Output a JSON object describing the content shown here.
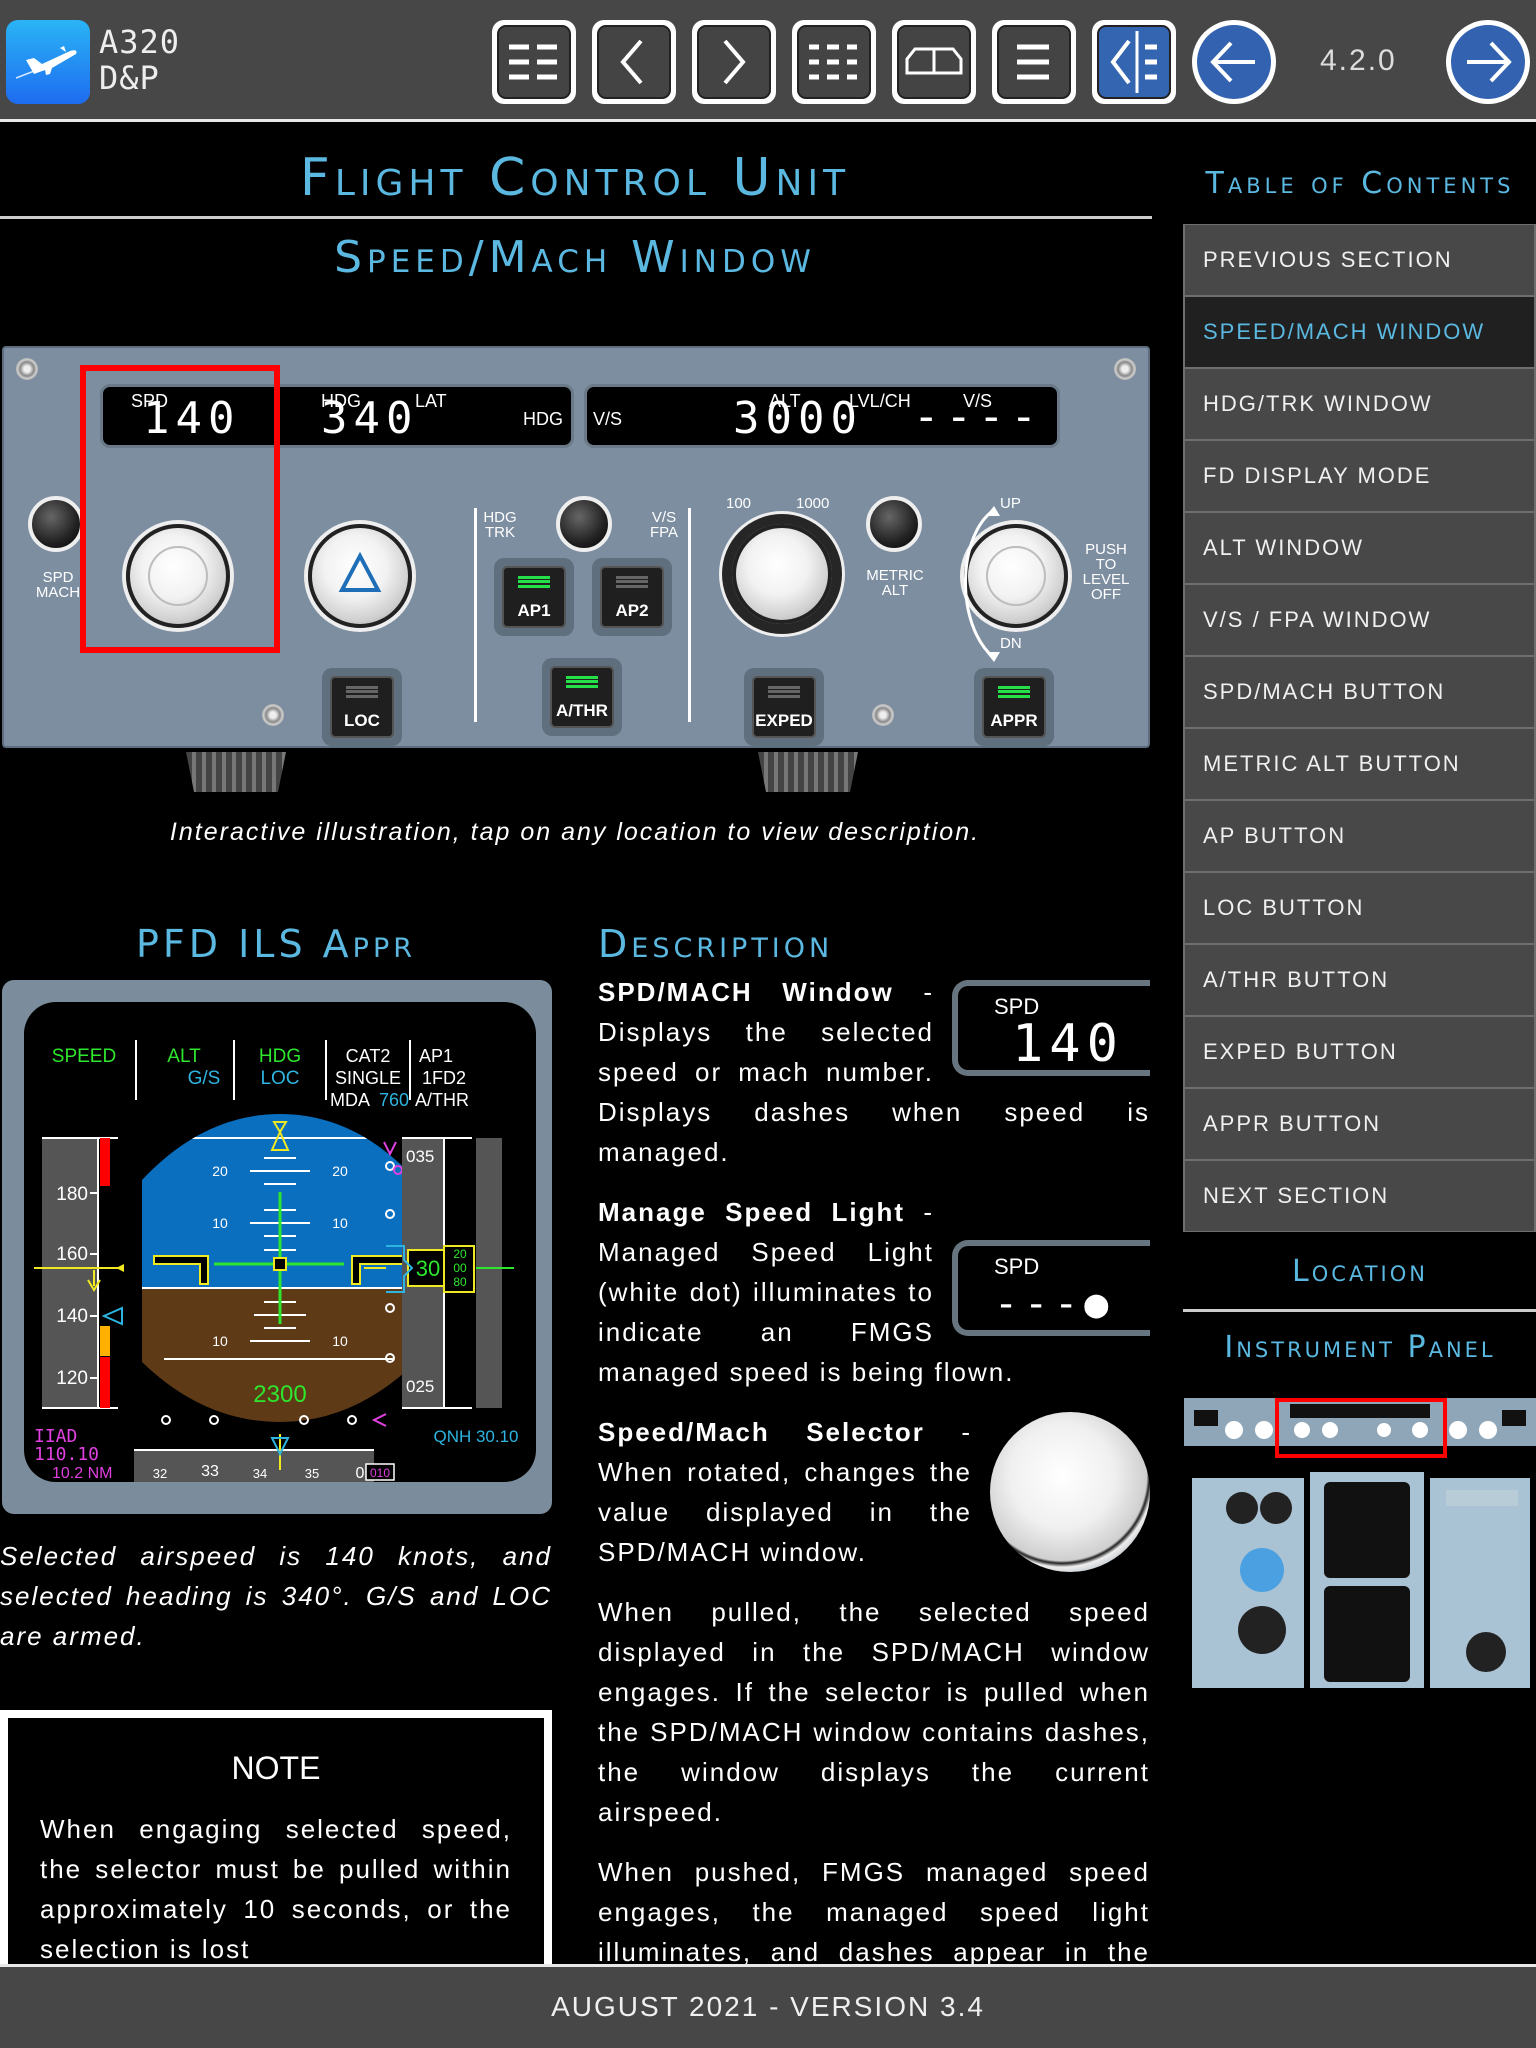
{
  "app": {
    "name_line1": "A320",
    "name_line2": "D&P",
    "version": "4.2.0"
  },
  "toolbar": {
    "buttons": [
      {
        "name": "menu-grid-icon",
        "active": false
      },
      {
        "name": "chevron-left-icon",
        "active": false
      },
      {
        "name": "chevron-right-icon",
        "active": false
      },
      {
        "name": "list-grid-icon",
        "active": false
      },
      {
        "name": "panel-overview-icon",
        "active": false
      },
      {
        "name": "list-icon",
        "active": false
      },
      {
        "name": "toc-sidebar-icon",
        "active": true
      }
    ],
    "back_icon": "arrow-left-icon",
    "forward_icon": "arrow-right-icon"
  },
  "header": {
    "title": "Flight Control Unit",
    "subtitle": "Speed/Mach Window"
  },
  "fcu": {
    "spd_label": "SPD",
    "spd_value": "140",
    "hdg_label": "HDG",
    "lat_label": "LAT",
    "hdg_value": "340",
    "hdg_right_label": "HDG",
    "vs_label": "V/S",
    "alt_label": "ALT",
    "lvlch_label": "LVL/CH",
    "vs_label2": "V/S",
    "alt_value": "3000",
    "vs_value": "----",
    "spd_mach_label": "SPD\nMACH",
    "hdg_trk_label": "HDG\nTRK",
    "vs_fpa_label": "V/S\nFPA",
    "alt_100": "100",
    "alt_1000": "1000",
    "metric_alt_label": "METRIC\nALT",
    "up_label": "UP",
    "dn_label": "DN",
    "push_label": "PUSH\nTO\nLEVEL\nOFF",
    "buttons": [
      {
        "label": "LOC",
        "on": false
      },
      {
        "label": "AP1",
        "on": true
      },
      {
        "label": "AP2",
        "on": false
      },
      {
        "label": "A/THR",
        "on": true
      },
      {
        "label": "EXPED",
        "on": false
      },
      {
        "label": "APPR",
        "on": true
      }
    ]
  },
  "caption": "Interactive illustration, tap on any location to view description.",
  "pfd_section": {
    "title": "PFD ILS Appr",
    "fma": {
      "col1": "SPEED",
      "col2a": "ALT",
      "col2b": "G/S",
      "col3a": "HDG",
      "col3b": "LOC",
      "col4a": "CAT2",
      "col4b": "SINGLE",
      "col4c": "MDA",
      "col4d": "760",
      "col5a": "AP1",
      "col5b": "1FD2",
      "col5c": "A/THR"
    },
    "speed_ticks": [
      "180",
      "160",
      "140",
      "120"
    ],
    "pitch_labels": [
      "20",
      "10",
      "10"
    ],
    "alt_ticks": [
      "035",
      "025"
    ],
    "alt_readout": "30",
    "alt_drum": [
      "20",
      "00",
      "80"
    ],
    "decision_alt": "2300",
    "ils_ident": "IIAD",
    "ils_freq": "110.10",
    "ils_dist": "10.2 NM",
    "qnh": "QNH 30.10",
    "heading_ticks": [
      "32",
      "33",
      "34",
      "35",
      "0"
    ],
    "heading_box": "010",
    "colors": {
      "green": "#2ee62e",
      "cyan": "#2eb4e0",
      "magenta": "#e040e0",
      "yellow": "#f0e820",
      "sky": "#0a6fbf",
      "ground": "#5e3a16"
    },
    "caption": "Selected airspeed is 140 knots, and selected heading is 340°. G/S and LOC are armed."
  },
  "note": {
    "title": "NOTE",
    "body": "When engaging selected speed, the selector must be pulled within approximately 10 seconds, or the selection is lost"
  },
  "description": {
    "title": "Description",
    "items": [
      {
        "heading": "SPD/MACH Window",
        "text": " - Displays the selected speed or mach number. Displays dashes when speed is managed.",
        "lcd_label": "SPD",
        "lcd_value": "140"
      },
      {
        "heading": "Manage Speed Light",
        "text": " - Managed Speed Light (white dot) illuminates to indicate an FMGS managed speed is being flown.",
        "lcd_label": "SPD",
        "lcd_value": "---●"
      },
      {
        "heading": "Speed/Mach Selector",
        "text": " - When rotated, changes the value displayed in the SPD/MACH window."
      }
    ],
    "paragraphs": [
      "When pulled, the selected speed displayed in the SPD/MACH window engages. If the selector is pulled when the SPD/MACH window contains dashes, the window displays the current airspeed.",
      "When pushed, FMGS managed speed engages, the managed speed light illuminates, and dashes appear in the SPD/MACH window."
    ]
  },
  "toc": {
    "title": "Table of Contents",
    "items": [
      {
        "label": "PREVIOUS SECTION",
        "active": false
      },
      {
        "label": "SPEED/MACH WINDOW",
        "active": true
      },
      {
        "label": "HDG/TRK WINDOW",
        "active": false
      },
      {
        "label": "FD DISPLAY MODE",
        "active": false
      },
      {
        "label": "ALT WINDOW",
        "active": false
      },
      {
        "label": "V/S / FPA WINDOW",
        "active": false
      },
      {
        "label": "SPD/MACH BUTTON",
        "active": false
      },
      {
        "label": "METRIC ALT BUTTON",
        "active": false
      },
      {
        "label": "AP BUTTON",
        "active": false
      },
      {
        "label": "LOC BUTTON",
        "active": false
      },
      {
        "label": "A/THR BUTTON",
        "active": false
      },
      {
        "label": "EXPED BUTTON",
        "active": false
      },
      {
        "label": "APPR BUTTON",
        "active": false
      },
      {
        "label": "NEXT SECTION",
        "active": false
      }
    ]
  },
  "location": {
    "title": "Location",
    "panel_title": "Instrument Panel"
  },
  "footer": {
    "text": "AUGUST 2021 - VERSION 3.4"
  }
}
